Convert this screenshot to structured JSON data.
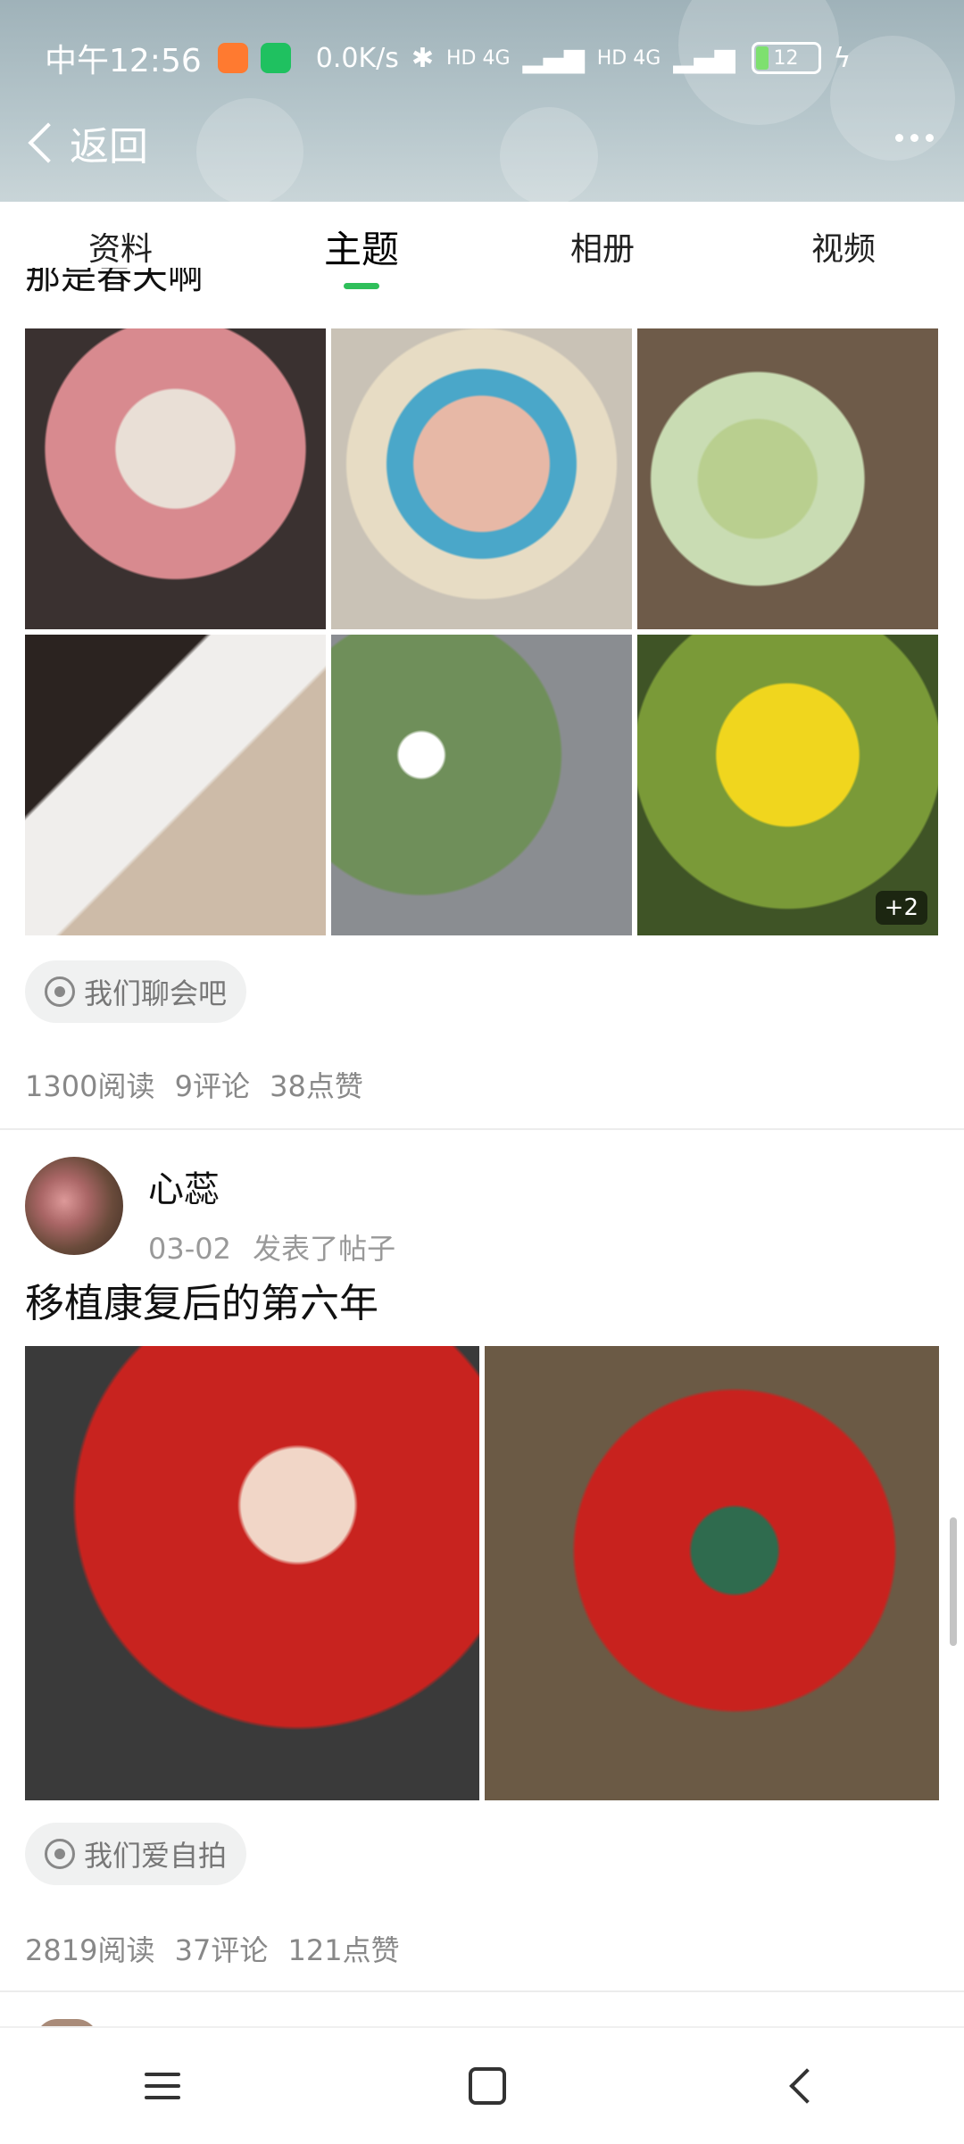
{
  "status_bar": {
    "time": "中午12:56",
    "speed": "0.0K/s",
    "network1": "HD 4G",
    "network2": "HD 4G",
    "battery": "12"
  },
  "nav": {
    "back_label": "返回"
  },
  "tabs": [
    {
      "label": "资料",
      "active": false
    },
    {
      "label": "主题",
      "active": true
    },
    {
      "label": "相册",
      "active": false
    },
    {
      "label": "视频",
      "active": false
    }
  ],
  "posts": [
    {
      "title_partial": "那是春天啊",
      "image_more": "+2",
      "topic": "我们聊会吧",
      "stats": {
        "reads": "1300阅读",
        "comments": "9评论",
        "likes": "38点赞"
      }
    },
    {
      "author": "心蕊",
      "date": "03-02",
      "action": "发表了帖子",
      "title": "移植康复后的第六年",
      "topic": "我们爱自拍",
      "stats": {
        "reads": "2819阅读",
        "comments": "37评论",
        "likes": "121点赞"
      }
    }
  ],
  "colors": {
    "accent": "#2fbf5a",
    "header_bg": "#9fb2b9",
    "muted_text": "#888888"
  }
}
